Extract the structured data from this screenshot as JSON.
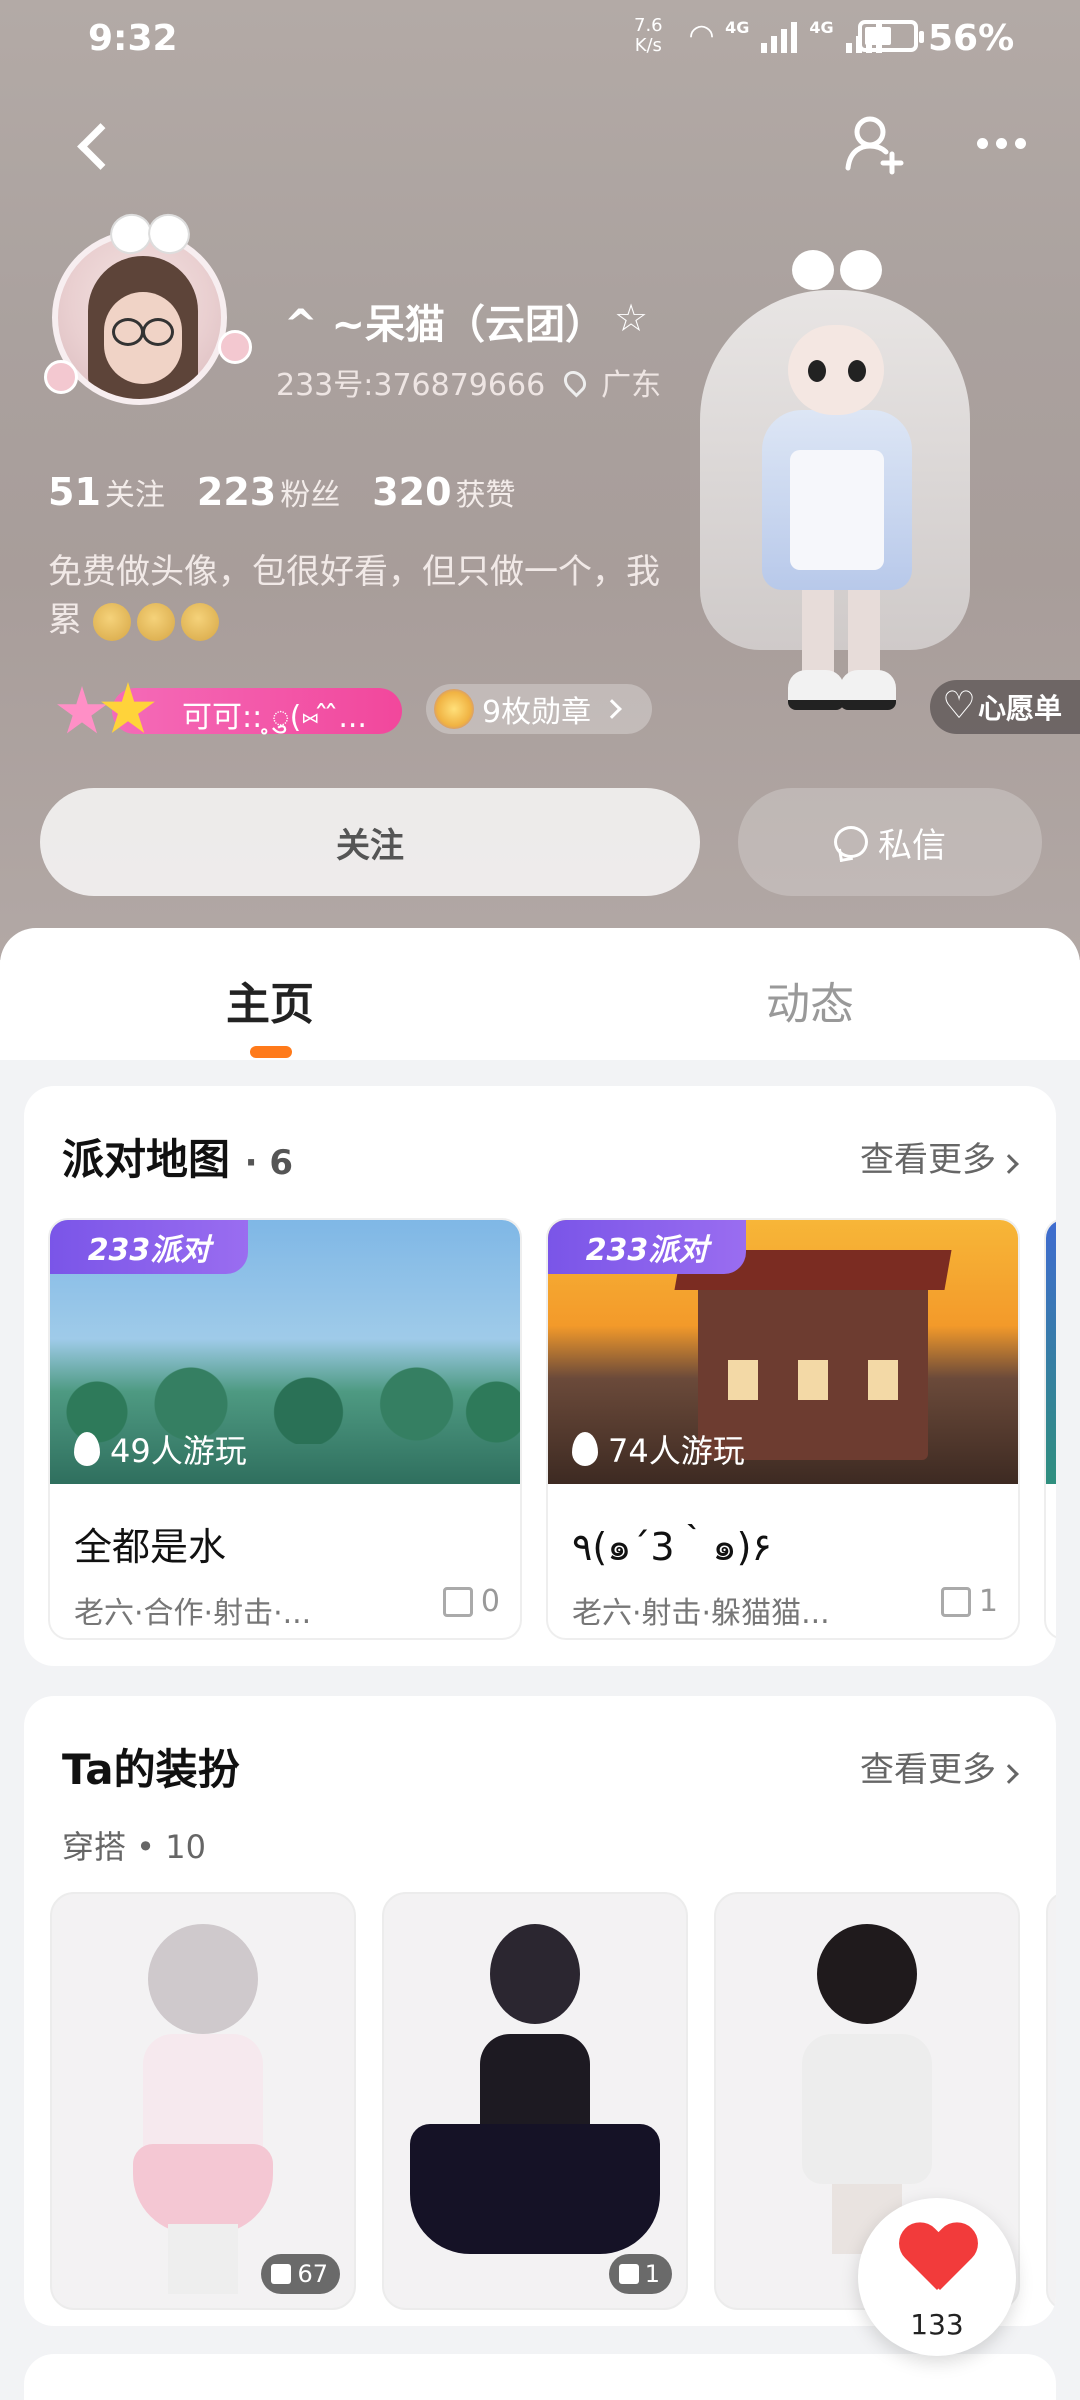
{
  "status_bar": {
    "time": "9:32",
    "net_speed": "7.6",
    "net_unit": "K/s",
    "sim1": "4G",
    "sim2": "4G",
    "battery_level": 0.56,
    "battery_pct": "56%"
  },
  "profile": {
    "username": "^ ~呆猫（云团）",
    "uid_label": "233号:376879666",
    "location": "广东",
    "stats": [
      {
        "value": "51",
        "label": "关注"
      },
      {
        "value": "223",
        "label": "粉丝"
      },
      {
        "value": "320",
        "label": "获赞"
      }
    ],
    "bio": "免费做头像，包很好看，但只做一个，我累",
    "fan_badge": "可可:: ̥ु(⑅ ̂ ̂...",
    "medals": "9枚勋章",
    "wishlist": "心愿单",
    "follow_button": "关注",
    "message_button": "私信"
  },
  "tabs": [
    {
      "label": "主页",
      "active": true
    },
    {
      "label": "动态",
      "active": false
    }
  ],
  "party_maps": {
    "title": "派对地图",
    "count": "· 6",
    "more": "查看更多",
    "items": [
      {
        "badge": "233派对",
        "players": "49人游玩",
        "name": "全都是水",
        "tags": "老六·合作·射击·...",
        "likes": "0"
      },
      {
        "badge": "233派对",
        "players": "74人游玩",
        "name": "٩(๑´3｀๑)۶",
        "tags": "老六·射击·躲猫猫...",
        "likes": "1"
      }
    ]
  },
  "outfits": {
    "title": "Ta的装扮",
    "more": "查看更多",
    "caption": "穿搭 • 10",
    "items": [
      {
        "likes": "67"
      },
      {
        "likes": "1"
      },
      {
        "likes": ""
      }
    ]
  },
  "fab": {
    "count": "133"
  },
  "colors": {
    "accent": "#ff7a1a",
    "party_badge": "#7a55e8",
    "like_red": "#f23b3b"
  },
  "icons": [
    "back-icon",
    "add-friend-icon",
    "more-icon",
    "star-icon",
    "location-icon",
    "chat-icon",
    "heart-icon",
    "flame-icon",
    "thumb-up-icon"
  ]
}
